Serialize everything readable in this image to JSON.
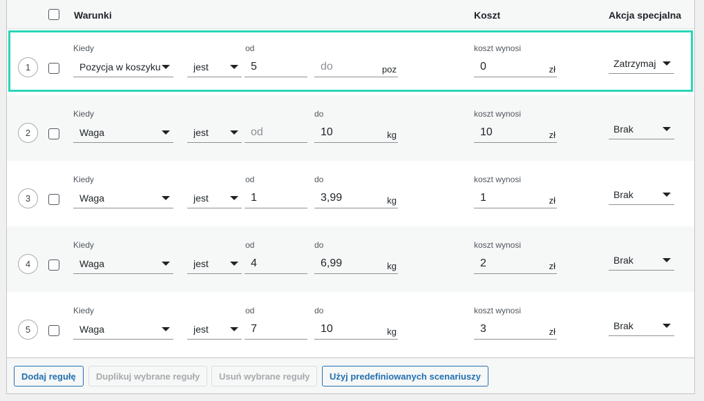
{
  "header": {
    "conditions": "Warunki",
    "cost": "Koszt",
    "special_action": "Akcja specjalna"
  },
  "rows": [
    {
      "num": "1",
      "when_label": "Kiedy",
      "when": "Pozycja w koszyku",
      "op": "jest",
      "from_label": "od",
      "from": "5",
      "to_label": "",
      "to": "do",
      "unit": "poz",
      "cost_label": "koszt wynosi",
      "cost": "0",
      "currency": "zł",
      "action": "Zatrzymaj"
    },
    {
      "num": "2",
      "when_label": "Kiedy",
      "when": "Waga",
      "op": "jest",
      "from_label": "",
      "from": "od",
      "to_label": "do",
      "to": "10",
      "unit": "kg",
      "cost_label": "koszt wynosi",
      "cost": "10",
      "currency": "zł",
      "action": "Brak"
    },
    {
      "num": "3",
      "when_label": "Kiedy",
      "when": "Waga",
      "op": "jest",
      "from_label": "od",
      "from": "1",
      "to_label": "do",
      "to": "3,99",
      "unit": "kg",
      "cost_label": "koszt wynosi",
      "cost": "1",
      "currency": "zł",
      "action": "Brak"
    },
    {
      "num": "4",
      "when_label": "Kiedy",
      "when": "Waga",
      "op": "jest",
      "from_label": "od",
      "from": "4",
      "to_label": "do",
      "to": "6,99",
      "unit": "kg",
      "cost_label": "koszt wynosi",
      "cost": "2",
      "currency": "zł",
      "action": "Brak"
    },
    {
      "num": "5",
      "when_label": "Kiedy",
      "when": "Waga",
      "op": "jest",
      "from_label": "od",
      "from": "7",
      "to_label": "do",
      "to": "10",
      "unit": "kg",
      "cost_label": "koszt wynosi",
      "cost": "3",
      "currency": "zł",
      "action": "Brak"
    }
  ],
  "footer": {
    "add_rule": "Dodaj regułę",
    "duplicate": "Duplikuj wybrane reguły",
    "remove": "Usuń wybrane reguły",
    "predefined": "Użyj predefiniowanych scenariuszy"
  },
  "colors": {
    "selected_outline": "#2ad5b7",
    "primary": "#2271b1"
  }
}
